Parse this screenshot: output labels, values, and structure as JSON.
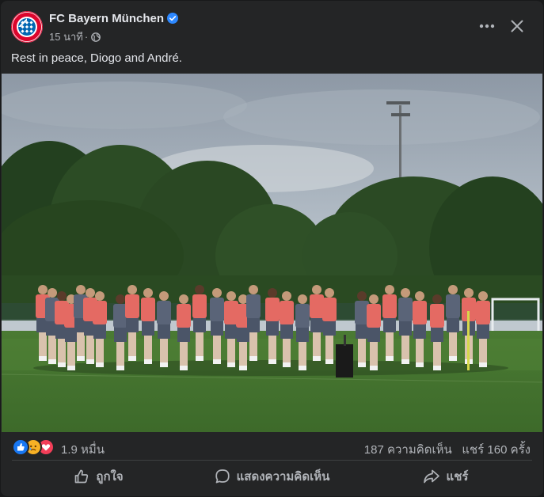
{
  "post": {
    "page_name": "FC Bayern München",
    "time": "15 นาที",
    "dot": "·",
    "caption": "Rest in peace, Diogo and André."
  },
  "reactions": {
    "count": "1.9 หมื่น",
    "types": [
      "like",
      "sad",
      "love"
    ],
    "colors": {
      "like": "#1877f2",
      "sad": "#f7b125",
      "love": "#f33e58"
    }
  },
  "stats": {
    "comments": "187 ความคิดเห็น",
    "shares": "แชร์ 160 ครั้ง"
  },
  "actions": {
    "like": "ถูกใจ",
    "comment": "แสดงความคิดเห็น",
    "share": "แชร์"
  },
  "colors": {
    "card_bg": "#242526",
    "verified": "#2d88ff",
    "bayern_red": "#dc052d",
    "bayern_blue": "#0066b2"
  }
}
